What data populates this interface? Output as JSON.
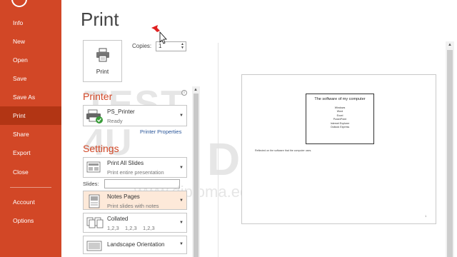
{
  "sidebar": {
    "items": [
      {
        "label": "Info"
      },
      {
        "label": "New"
      },
      {
        "label": "Open"
      },
      {
        "label": "Save"
      },
      {
        "label": "Save As"
      },
      {
        "label": "Print",
        "active": true
      },
      {
        "label": "Share"
      },
      {
        "label": "Export"
      },
      {
        "label": "Close"
      },
      {
        "label": "Account"
      },
      {
        "label": "Options"
      }
    ],
    "accent": "#d24726"
  },
  "page_title": "Print",
  "print_button": {
    "label": "Print",
    "icon": "printer-icon"
  },
  "copies": {
    "label": "Copies:",
    "value": "1"
  },
  "printer": {
    "section_title": "Printer",
    "name": "PS_Printer",
    "status": "Ready",
    "properties_link": "Printer Properties"
  },
  "settings": {
    "section_title": "Settings",
    "print_range": {
      "title": "Print All Slides",
      "subtitle": "Print entire presentation"
    },
    "slides_label": "Slides:",
    "slides_value": "",
    "layout": {
      "title": "Notes Pages",
      "subtitle": "Print slides with notes"
    },
    "collation": {
      "title": "Collated",
      "subtitle": "1,2,3    1,2,3    1,2,3"
    },
    "orientation": {
      "title": "Landscape Orientation"
    }
  },
  "preview": {
    "slide_title": "The software of my computer",
    "slide_items": [
      "Windows",
      "Word",
      "Excel",
      "PowerPoint",
      "Internet Explorer",
      "Outlook Express"
    ],
    "note_text": "Reflected on the software that the computer uses.",
    "page_number": "1"
  },
  "watermark": {
    "line1": "TEST",
    "line2": "4U",
    "badge": "B",
    "brand": "DIPLOMA",
    "url": "www.diploma.edu.gr"
  }
}
